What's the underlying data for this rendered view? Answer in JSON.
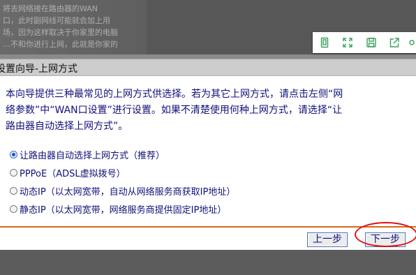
{
  "background": {
    "text_lines": [
      "将去网络接在路由器的WAN",
      "口，此时副网线可能就会加上用",
      "场，因为这样取决于你家里的电脑",
      "…不和你进行上网，此就是你家的"
    ]
  },
  "toolbar": {
    "icons": [
      "copy-icon",
      "fullscreen-icon",
      "save-icon",
      "share-icon",
      "more-icon"
    ]
  },
  "dialog": {
    "title": "设置向导-上网方式",
    "description": [
      "本向导提供三种最常见的上网方式供选择。若为其它上网方式，请点击左侧“网",
      "络参数”中“WAN口设置”进行设置。如果不清楚使用何种上网方式，请选择“让",
      "路由器自动选择上网方式”。"
    ],
    "options": [
      {
        "label": "让路由器自动选择上网方式（推荐）",
        "checked": true
      },
      {
        "label": "PPPoE（ADSL虚拟拨号）",
        "checked": false
      },
      {
        "label": "动态IP（以太网宽带，自动从网络服务商获取IP地址）",
        "checked": false
      },
      {
        "label": "静态IP（以太网宽带，网络服务商提供固定IP地址）",
        "checked": false
      }
    ],
    "prev_label": "上一步",
    "next_label": "下一步"
  },
  "colors": {
    "text": "#10107a",
    "divider": "#d2691e",
    "annotation": "#e01010"
  }
}
